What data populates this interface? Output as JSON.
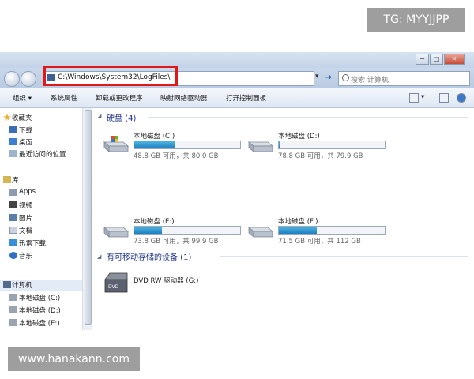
{
  "overlay": {
    "tag": "TG: MYYJJPP",
    "url": "www.hanakann.com"
  },
  "window": {
    "controls": [
      "−",
      "□",
      "✕"
    ]
  },
  "address": {
    "path": "C:\\Windows\\System32\\LogFiles\\",
    "search_placeholder": "搜索 计算机"
  },
  "toolbar": [
    "组织 ▾",
    "系统属性",
    "卸载或更改程序",
    "映射网络驱动器",
    "打开控制面板"
  ],
  "sidebar": {
    "favorites": "收藏夹",
    "fav_items": [
      "下载",
      "桌面",
      "最近访问的位置"
    ],
    "libraries": "库",
    "lib_items": [
      "Apps",
      "视频",
      "图片",
      "文档",
      "迅雷下载",
      "音乐"
    ],
    "computer": "计算机",
    "comp_items": [
      "本地磁盘 (C:)",
      "本地磁盘 (D:)",
      "本地磁盘 (E:)"
    ]
  },
  "content": {
    "hard_disks_title": "硬盘 (4)",
    "removable_title": "有可移动存储的设备 (1)",
    "drives": [
      {
        "name": "本地磁盘 (C:)",
        "free": "48.8 GB 可用，共 80.0 GB",
        "fill": 0.39
      },
      {
        "name": "本地磁盘 (D:)",
        "free": "78.8 GB 可用，共 79.9 GB",
        "fill": 0.014
      },
      {
        "name": "本地磁盘 (E:)",
        "free": "73.8 GB 可用，共 99.9 GB",
        "fill": 0.26
      },
      {
        "name": "本地磁盘 (F:)",
        "free": "71.5 GB 可用，共 112 GB",
        "fill": 0.36
      }
    ],
    "dvd": {
      "name": "DVD RW 驱动器 (G:)",
      "icon_label": "DVD"
    }
  }
}
